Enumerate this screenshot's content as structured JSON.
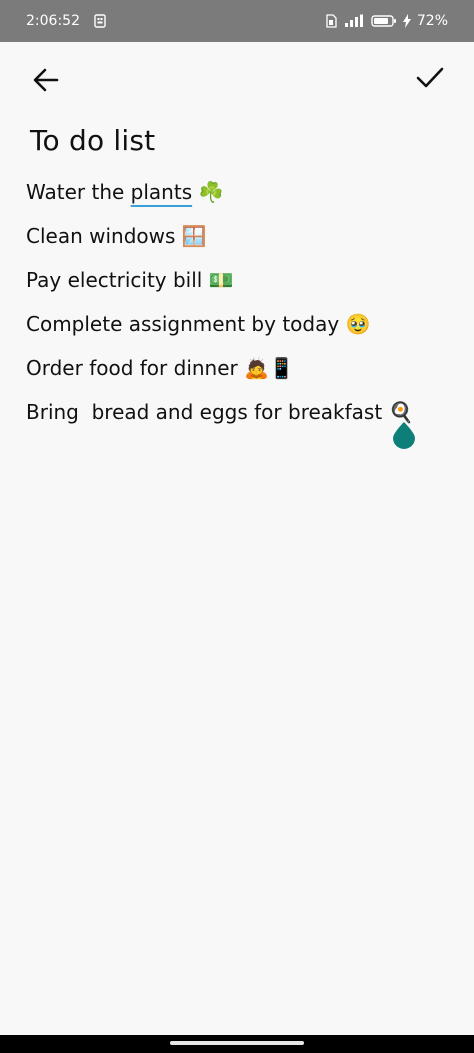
{
  "status_bar": {
    "time": "2:06:52",
    "battery_percent": "72%",
    "icons": [
      "screenshot-icon",
      "sim-icon",
      "signal-icon",
      "battery-icon",
      "charging-icon"
    ]
  },
  "toolbar": {
    "back_icon": "arrow-left-icon",
    "save_icon": "checkmark-icon"
  },
  "note": {
    "title": "To do list",
    "lines": [
      {
        "before": "Water the ",
        "underlined": "plants",
        "after": " ☘️"
      },
      {
        "before": "Clean windows 🪟",
        "underlined": "",
        "after": ""
      },
      {
        "before": "Pay electricity bill 💵",
        "underlined": "",
        "after": ""
      },
      {
        "before": "Complete assignment by today 🥹",
        "underlined": "",
        "after": ""
      },
      {
        "before": "Order food for dinner 🙇📱",
        "underlined": "",
        "after": ""
      },
      {
        "before": "Bring  bread and eggs for breakfast 🍳",
        "underlined": "",
        "after": ""
      }
    ]
  },
  "colors": {
    "status_bar_bg": "#7b7b7b",
    "page_bg": "#f8f8f8",
    "cursor_handle": "#0e7f78",
    "underline": "#3aa0d8"
  }
}
